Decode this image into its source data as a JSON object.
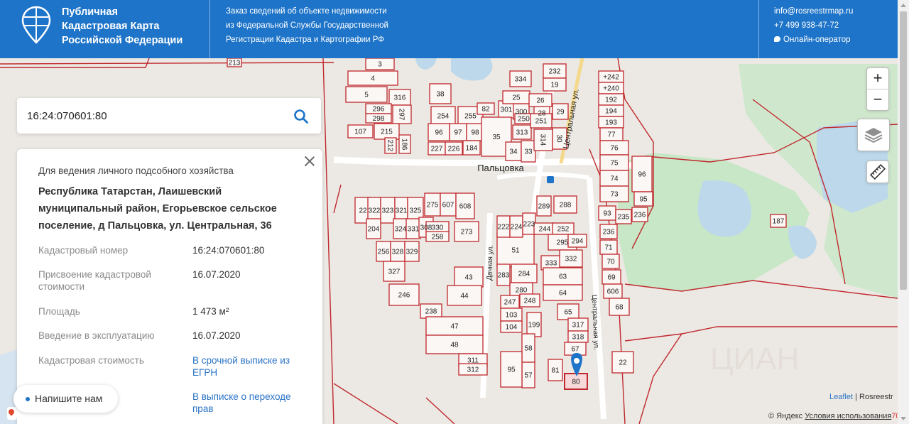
{
  "header": {
    "brand": [
      "Публичная",
      "Кадастровая Карта",
      "Российской Федерации"
    ],
    "description": [
      "Заказ сведений об объекте недвижимости",
      "из Федеральной Службы Государственной",
      "Регистрации Кадастра и Картографии РФ"
    ],
    "email": "info@rosreestrmap.ru",
    "phone": "+7 499 938-47-72",
    "operator": "Онлайн-оператор"
  },
  "search": {
    "value": "16:24:070601:80"
  },
  "info": {
    "purpose": "Для ведения личного подсобного хозяйства",
    "address": "Республика Татарстан, Лаишевский муниципальный район, Егорьевское сельское поселение, д Пальцовка, ул. Центральная, 36",
    "rows": [
      {
        "label": "Кадастровый номер",
        "value": "16:24:070601:80"
      },
      {
        "label": "Присвоение кадастровой стоимости",
        "value": "16.07.2020"
      },
      {
        "label": "Площадь",
        "value": "1 473 м²"
      },
      {
        "label": "Введение в эксплуатацию",
        "value": "16.07.2020"
      },
      {
        "label": "Кадастровая стоимость",
        "value": "В срочной выписке из ЕГРН"
      },
      {
        "label": "",
        "value": "В выписке о переходе прав"
      }
    ]
  },
  "chat": {
    "label": "Напишите нам"
  },
  "map": {
    "village": "Пальцовка",
    "streets": [
      "Центральная ул.",
      "Дачная ул.",
      "Центральная ул."
    ],
    "parcels": [
      "213",
      "3",
      "4",
      "5",
      "316",
      "296",
      "298",
      "297",
      "107",
      "215",
      "212",
      "186",
      "38",
      "254",
      "255",
      "82",
      "301",
      "300",
      "28",
      "29",
      "96",
      "97",
      "98",
      "227",
      "226",
      "184",
      "35",
      "34",
      "33",
      "314",
      "313",
      "30",
      "25",
      "26",
      "250",
      "251",
      "232",
      "19",
      "334",
      "+242",
      "+240",
      "192",
      "194",
      "193",
      "77",
      "76",
      "75",
      "74",
      "73",
      "96",
      "95",
      "93",
      "235",
      "236",
      "236",
      "71",
      "70",
      "69",
      "606",
      "68",
      "187",
      "22",
      "22",
      "322",
      "323",
      "321",
      "325",
      "275",
      "607",
      "608",
      "204",
      "324",
      "331",
      "308",
      "330",
      "258",
      "273",
      "256",
      "328",
      "329",
      "327",
      "246",
      "51",
      "43",
      "44",
      "238",
      "47",
      "48",
      "311",
      "312",
      "289",
      "288",
      "222",
      "224",
      "223",
      "244",
      "252",
      "295",
      "294",
      "333",
      "332",
      "63",
      "64",
      "283",
      "284",
      "280",
      "247",
      "248",
      "65",
      "103",
      "104",
      "199",
      "317",
      "318",
      "67",
      "81",
      "80",
      "58",
      "57",
      "95"
    ],
    "attribution_leaflet": "Leaflet",
    "attribution_rosreestr": "| Rosreestr",
    "yandex": "© Яндекс",
    "terms": "Условия использования",
    "terms_suffix": "70"
  },
  "icons": [
    "emblem-logo-icon",
    "search-icon",
    "chat-bubble-icon",
    "layers-icon",
    "ruler-icon",
    "map-pin-icon"
  ]
}
